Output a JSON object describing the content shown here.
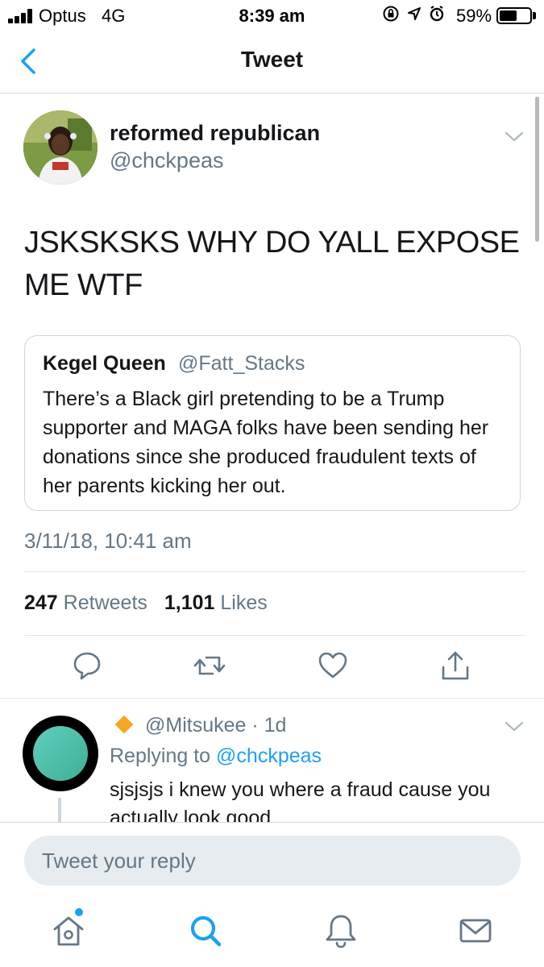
{
  "status_bar": {
    "carrier": "Optus",
    "network": "4G",
    "time": "8:39 am",
    "battery_percent": "59%",
    "battery_level": 0.59,
    "icons": [
      "lock-rotation-icon",
      "location-icon",
      "alarm-icon"
    ]
  },
  "nav": {
    "title": "Tweet",
    "back_icon": "chevron-left-icon"
  },
  "tweet": {
    "display_name": "reformed republican",
    "handle": "@chckpeas",
    "text": "JSKSKSKS WHY DO YALL EXPOSE ME WTF",
    "quoted": {
      "display_name": "Kegel Queen",
      "handle": "@Fatt_Stacks",
      "text": "There’s a Black girl pretending to be a Trump supporter and MAGA folks have been sending her donations since she produced fraudulent texts of her parents kicking her out."
    },
    "timestamp": "3/11/18, 10:41 am",
    "stats": {
      "retweets_count": "247",
      "retweets_label": "Retweets",
      "likes_count": "1,101",
      "likes_label": "Likes"
    },
    "actions": [
      "reply-icon",
      "retweet-icon",
      "like-icon",
      "share-icon"
    ]
  },
  "reply": {
    "handle": "@Mitsukee",
    "time": "· 1d",
    "replying_prefix": "Replying to",
    "replying_to": "@chckpeas",
    "text": "sjsjsjs i knew you where a fraud cause you actually look good"
  },
  "composer": {
    "placeholder": "Tweet your reply"
  },
  "tab_bar": {
    "items": [
      "home-icon",
      "search-icon",
      "notifications-icon",
      "messages-icon"
    ]
  },
  "colors": {
    "accent": "#1da1f2",
    "secondary_text": "#657786",
    "border": "#e1e8ed",
    "badge": "#f5a623"
  }
}
